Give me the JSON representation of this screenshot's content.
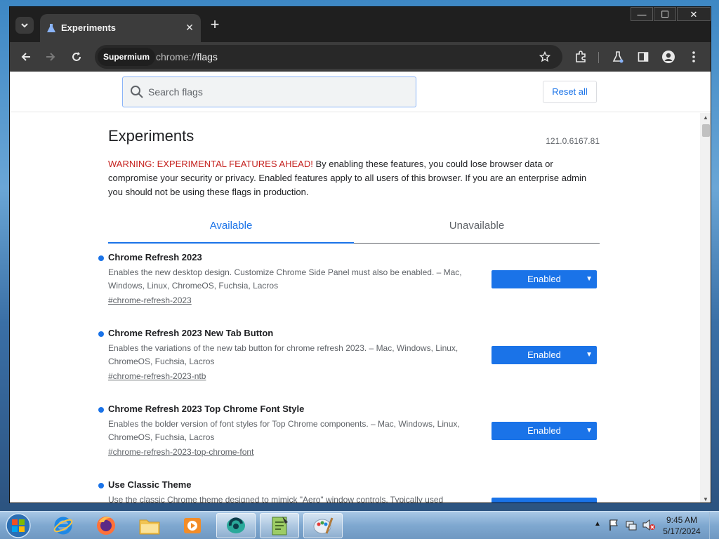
{
  "browser": {
    "tab_title": "Experiments",
    "tab_close": "✕",
    "new_tab": "+",
    "window_controls": {
      "minimize": "—",
      "maximize": "☐",
      "close": "✕"
    },
    "omnibox": {
      "chip": "Supermium",
      "url_scheme": "chrome://",
      "url_host": "flags"
    }
  },
  "flags_header": {
    "search_placeholder": "Search flags",
    "reset_label": "Reset all"
  },
  "page": {
    "title": "Experiments",
    "version": "121.0.6167.81",
    "warning_label": "WARNING: EXPERIMENTAL FEATURES AHEAD!",
    "warning_text": " By enabling these features, you could lose browser data or compromise your security or privacy. Enabled features apply to all users of this browser. If you are an enterprise admin you should not be using these flags in production.",
    "tabs": {
      "available": "Available",
      "unavailable": "Unavailable"
    }
  },
  "experiments": [
    {
      "title": "Chrome Refresh 2023",
      "description": "Enables the new desktop design. Customize Chrome Side Panel must also be enabled. – Mac, Windows, Linux, ChromeOS, Fuchsia, Lacros",
      "link": "#chrome-refresh-2023",
      "value": "Enabled"
    },
    {
      "title": "Chrome Refresh 2023 New Tab Button",
      "description": "Enables the variations of the new tab button for chrome refresh 2023. – Mac, Windows, Linux, ChromeOS, Fuchsia, Lacros",
      "link": "#chrome-refresh-2023-ntb",
      "value": "Enabled"
    },
    {
      "title": "Chrome Refresh 2023 Top Chrome Font Style",
      "description": "Enables the bolder version of font styles for Top Chrome components. – Mac, Windows, Linux, ChromeOS, Fuchsia, Lacros",
      "link": "#chrome-refresh-2023-top-chrome-font",
      "value": "Enabled"
    },
    {
      "title": "Use Classic Theme",
      "description": "Use the classic Chrome theme designed to mimick \"Aero\" window controls. Typically used",
      "link": "",
      "value": ""
    }
  ],
  "taskbar": {
    "time": "9:45 AM",
    "date": "5/17/2024",
    "apps": [
      "internet-explorer-icon",
      "firefox-icon",
      "file-explorer-icon",
      "media-player-icon",
      "browser-icon",
      "notepad-icon",
      "paint-icon"
    ]
  },
  "colors": {
    "accent": "#1a73e8",
    "warning": "#c5221f",
    "tabstrip": "#1f1f1f",
    "toolbar": "#3c3c3c"
  }
}
